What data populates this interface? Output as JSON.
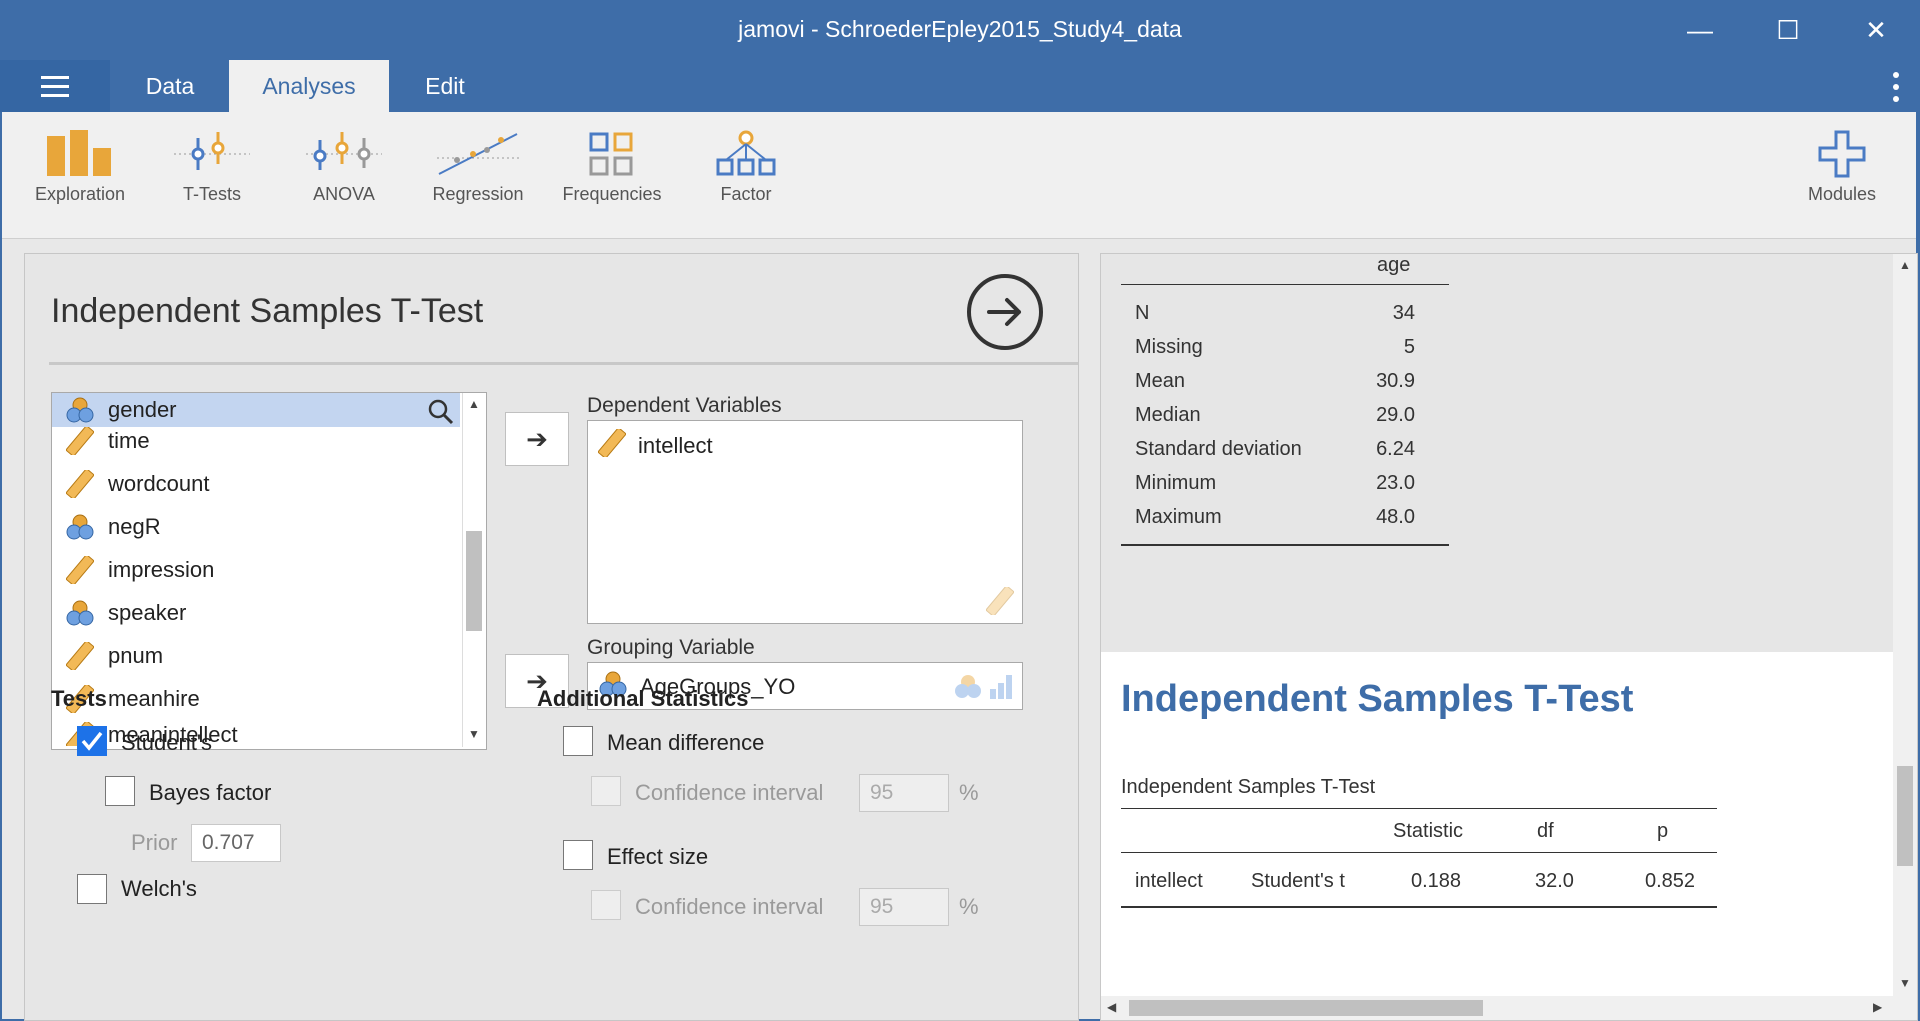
{
  "window": {
    "title": "jamovi - SchroederEpley2015_Study4_data",
    "minimize": "—",
    "maximize": "☐",
    "close": "✕"
  },
  "tabs": [
    {
      "label": "Data"
    },
    {
      "label": "Analyses"
    },
    {
      "label": "Edit"
    }
  ],
  "ribbon": {
    "exploration": "Exploration",
    "ttests": "T-Tests",
    "anova": "ANOVA",
    "regression": "Regression",
    "frequencies": "Frequencies",
    "factor": "Factor",
    "modules": "Modules"
  },
  "options": {
    "title": "Independent Samples T-Test",
    "variables": [
      {
        "name": "gender",
        "type": "nominal"
      },
      {
        "name": "time",
        "type": "continuous"
      },
      {
        "name": "wordcount",
        "type": "continuous"
      },
      {
        "name": "negR",
        "type": "nominal"
      },
      {
        "name": "impression",
        "type": "continuous"
      },
      {
        "name": "speaker",
        "type": "nominal"
      },
      {
        "name": "pnum",
        "type": "continuous"
      },
      {
        "name": "meanhire",
        "type": "continuous"
      },
      {
        "name": "meanintellect",
        "type": "continuous"
      }
    ],
    "dependent_label": "Dependent Variables",
    "dependent_value": "intellect",
    "grouping_label": "Grouping Variable",
    "grouping_value": "AgeGroups_YO",
    "tests_header": "Tests",
    "students": "Student's",
    "bayes": "Bayes factor",
    "prior_label": "Prior",
    "prior_value": "0.707",
    "welchs": "Welch's",
    "additional_header": "Additional Statistics",
    "mean_diff": "Mean difference",
    "ci_label": "Confidence interval",
    "ci_value": "95",
    "pct": "%",
    "effect_size": "Effect size"
  },
  "results": {
    "desc_col": "age",
    "desc_rows": [
      {
        "label": "N",
        "value": "34"
      },
      {
        "label": "Missing",
        "value": "5"
      },
      {
        "label": "Mean",
        "value": "30.9"
      },
      {
        "label": "Median",
        "value": "29.0"
      },
      {
        "label": "Standard deviation",
        "value": "6.24"
      },
      {
        "label": "Minimum",
        "value": "23.0"
      },
      {
        "label": "Maximum",
        "value": "48.0"
      }
    ],
    "heading": "Independent Samples T-Test",
    "table_title": "Independent Samples T-Test",
    "columns": {
      "statistic": "Statistic",
      "df": "df",
      "p": "p"
    },
    "row": {
      "var": "intellect",
      "test": "Student's t",
      "statistic": "0.188",
      "df": "32.0",
      "p": "0.852"
    }
  },
  "colors": {
    "accent": "#3e6da8",
    "ribbon_icon": "#e8a63a",
    "checkbox": "#1d72e8"
  }
}
